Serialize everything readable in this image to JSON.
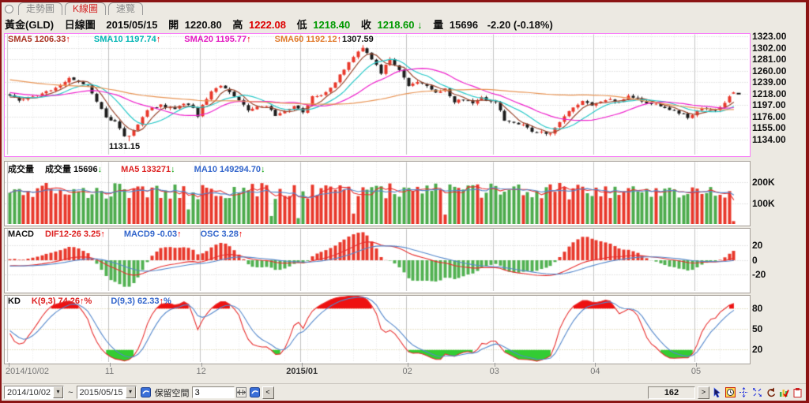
{
  "tabs": {
    "items": [
      {
        "label": "走勢圖",
        "active": false
      },
      {
        "label": "K線圖",
        "active": true
      },
      {
        "label": "速覽",
        "active": false
      }
    ]
  },
  "header": {
    "symbol": "黃金(GLD)",
    "chart_type": "日線圖",
    "date": "2015/05/15",
    "open_label": "開",
    "open": "1220.80",
    "high_label": "高",
    "high": "1222.08",
    "low_label": "低",
    "low": "1218.40",
    "close_label": "收",
    "close": "1218.60",
    "close_arrow": "↓",
    "vol_label": "量",
    "volume": "15696",
    "change": "-2.20 (-0.18%)"
  },
  "main_panel": {
    "legend": [
      {
        "label": "SMA5",
        "value": "1206.33",
        "arrow": "↑",
        "color": "#aa3322",
        "arrow_color": "#ee0000"
      },
      {
        "label": "SMA10",
        "value": "1197.74",
        "arrow": "↑",
        "color": "#00b4b4",
        "arrow_color": "#ee0000"
      },
      {
        "label": "SMA20",
        "value": "1195.77",
        "arrow": "↑",
        "color": "#e318c0",
        "arrow_color": "#ee0000"
      },
      {
        "label": "SMA60",
        "value": "1192.12",
        "arrow": "↑",
        "color": "#e07828",
        "arrow_color": "#ee0000"
      }
    ],
    "high_label": "1307.59",
    "low_label": "1131.15",
    "y_labels": [
      {
        "text": "1323.00",
        "v": 1323
      },
      {
        "text": "1302.00",
        "v": 1302
      },
      {
        "text": "1281.00",
        "v": 1281
      },
      {
        "text": "1260.00",
        "v": 1260
      },
      {
        "text": "1239.00",
        "v": 1239
      },
      {
        "text": "1218.00",
        "v": 1218
      },
      {
        "text": "1197.00",
        "v": 1197
      },
      {
        "text": "1176.00",
        "v": 1176
      },
      {
        "text": "1155.00",
        "v": 1155
      },
      {
        "text": "1134.00",
        "v": 1134
      }
    ]
  },
  "volume_panel": {
    "title": "成交量",
    "legend": [
      {
        "label": "成交量",
        "value": "15696",
        "arrow": "↓",
        "color": "#111111",
        "arrow_color": "#00a000"
      },
      {
        "label": "MA5",
        "value": "133271",
        "arrow": "↓",
        "color": "#dd2222",
        "arrow_color": "#00a000"
      },
      {
        "label": "MA10",
        "value": "149294.70",
        "arrow": "↓",
        "color": "#3366cc",
        "arrow_color": "#00a000"
      }
    ],
    "y_labels": [
      {
        "text": "200K",
        "v": 200000
      },
      {
        "text": "100K",
        "v": 100000
      }
    ]
  },
  "macd_panel": {
    "title": "MACD",
    "legend": [
      {
        "label": "DIF12-26",
        "value": "3.25",
        "arrow": "↑",
        "color": "#dd2222",
        "arrow_color": "#ee0000"
      },
      {
        "label": "MACD9",
        "value": "-0.03",
        "arrow": "↑",
        "color": "#3366cc",
        "arrow_color": "#ee0000"
      },
      {
        "label": "OSC",
        "value": "3.28",
        "arrow": "↑",
        "color": "#3366cc",
        "arrow_color": "#ee0000"
      }
    ],
    "y_labels": [
      {
        "text": "20",
        "v": 20
      },
      {
        "text": "0",
        "v": 0
      },
      {
        "text": "-20",
        "v": -20
      }
    ]
  },
  "kd_panel": {
    "title": "KD",
    "legend": [
      {
        "label": "K(9,3)",
        "value": "74.26",
        "arrow": "↑",
        "suffix": "%",
        "color": "#dd2222",
        "arrow_color": "#ee0000"
      },
      {
        "label": "D(9,3)",
        "value": "62.33",
        "arrow": "↑",
        "suffix": "%",
        "color": "#3366cc",
        "arrow_color": "#ee0000"
      }
    ],
    "y_labels": [
      {
        "text": "80",
        "v": 80
      },
      {
        "text": "50",
        "v": 50
      },
      {
        "text": "20",
        "v": 20
      }
    ]
  },
  "x_axis": {
    "labels": [
      {
        "text": "2014/10/02",
        "idx": 0,
        "align": "left",
        "bold": false
      },
      {
        "text": "11",
        "idx": 22,
        "bold": false
      },
      {
        "text": "12",
        "idx": 42,
        "bold": false
      },
      {
        "text": "2015/01",
        "idx": 64,
        "bold": true
      },
      {
        "text": "02",
        "idx": 87,
        "bold": false
      },
      {
        "text": "03",
        "idx": 106,
        "bold": false
      },
      {
        "text": "04",
        "idx": 128,
        "bold": false
      },
      {
        "text": "05",
        "idx": 150,
        "bold": false
      }
    ]
  },
  "toolbar": {
    "date_from": "2014/10/02",
    "range_sep": "~",
    "date_to": "2015/05/15",
    "reserve_label": "保留空間",
    "reserve_value": "3",
    "bar_count": "162",
    "prev": "<",
    "next": ">"
  },
  "chart_data": {
    "type": "candlestick",
    "bars": 159,
    "price_anchors": [
      [
        0,
        1214
      ],
      [
        2,
        1207
      ],
      [
        5,
        1212
      ],
      [
        8,
        1222
      ],
      [
        11,
        1234
      ],
      [
        13,
        1248
      ],
      [
        15,
        1241
      ],
      [
        17,
        1232
      ],
      [
        19,
        1205
      ],
      [
        20,
        1190
      ],
      [
        21,
        1173
      ],
      [
        23,
        1168
      ],
      [
        25,
        1140
      ],
      [
        26,
        1143
      ],
      [
        28,
        1162
      ],
      [
        30,
        1190
      ],
      [
        33,
        1197
      ],
      [
        36,
        1189
      ],
      [
        38,
        1201
      ],
      [
        40,
        1192
      ],
      [
        41,
        1175
      ],
      [
        42,
        1197
      ],
      [
        43,
        1210
      ],
      [
        44,
        1224
      ],
      [
        46,
        1232
      ],
      [
        48,
        1222
      ],
      [
        50,
        1206
      ],
      [
        52,
        1188
      ],
      [
        54,
        1194
      ],
      [
        56,
        1196
      ],
      [
        58,
        1178
      ],
      [
        60,
        1186
      ],
      [
        62,
        1195
      ],
      [
        64,
        1186
      ],
      [
        66,
        1212
      ],
      [
        68,
        1216
      ],
      [
        70,
        1230
      ],
      [
        72,
        1252
      ],
      [
        74,
        1276
      ],
      [
        76,
        1294
      ],
      [
        77,
        1301
      ],
      [
        78,
        1292
      ],
      [
        80,
        1272
      ],
      [
        81,
        1257
      ],
      [
        83,
        1283
      ],
      [
        85,
        1260
      ],
      [
        87,
        1234
      ],
      [
        89,
        1241
      ],
      [
        91,
        1232
      ],
      [
        93,
        1221
      ],
      [
        95,
        1227
      ],
      [
        97,
        1204
      ],
      [
        99,
        1209
      ],
      [
        101,
        1201
      ],
      [
        103,
        1213
      ],
      [
        104,
        1206
      ],
      [
        106,
        1204
      ],
      [
        108,
        1168
      ],
      [
        110,
        1164
      ],
      [
        112,
        1160
      ],
      [
        114,
        1150
      ],
      [
        116,
        1148
      ],
      [
        118,
        1145
      ],
      [
        120,
        1168
      ],
      [
        122,
        1186
      ],
      [
        124,
        1198
      ],
      [
        125,
        1204
      ],
      [
        127,
        1198
      ],
      [
        129,
        1203
      ],
      [
        131,
        1208
      ],
      [
        133,
        1202
      ],
      [
        135,
        1214
      ],
      [
        137,
        1210
      ],
      [
        139,
        1202
      ],
      [
        141,
        1199
      ],
      [
        143,
        1193
      ],
      [
        145,
        1187
      ],
      [
        147,
        1180
      ],
      [
        148,
        1174
      ],
      [
        150,
        1188
      ],
      [
        152,
        1192
      ],
      [
        154,
        1188
      ],
      [
        156,
        1200
      ],
      [
        157,
        1214
      ],
      [
        158,
        1218.6
      ]
    ],
    "special": {
      "low_idx": 26,
      "low_val": 1131.15,
      "high_idx": 77,
      "high_val": 1307.59,
      "last": {
        "open": 1220.8,
        "high": 1222.08,
        "low": 1218.4,
        "close": 1218.6
      }
    },
    "price_range": [
      1106,
      1327.5
    ],
    "volume_range": [
      0,
      300000
    ],
    "volume_specials": {
      "39": 72000,
      "57": 40000,
      "63": 30000,
      "75": 52000,
      "95": 47000,
      "158": 15696
    },
    "macd_range": [
      -43,
      43
    ],
    "osc_display_scale": 4,
    "kd_range": [
      2,
      98
    ],
    "month_ticks": [
      0,
      22,
      42,
      64,
      87,
      106,
      128,
      150
    ],
    "sma_periods": [
      5,
      10,
      20,
      60
    ],
    "colors": {
      "up": "#e8382b",
      "up_edge": "#b91c10",
      "down": "#1c1c1c",
      "sma5": "#9a4a32",
      "sma10": "#28c8c8",
      "sma20": "#ee22cc",
      "sma60": "#e89454",
      "vol_up": "#e8382b",
      "vol_down": "#4cab4c",
      "vol_ma5": "#e83030",
      "vol_ma10": "#5588cc",
      "dif": "#e83030",
      "dea": "#5588cc",
      "osc_up": "#e8382b",
      "osc_down": "#52b152",
      "k_line": "#e83030",
      "d_line": "#5588cc",
      "kd_hi_fill": "#ee1111",
      "kd_lo_fill": "#33cc33",
      "grid": "#cccccc",
      "grid_week": "#e4e4e4",
      "grid_month": "#c2c2c2",
      "kd_grid": "#cfc08f"
    }
  }
}
